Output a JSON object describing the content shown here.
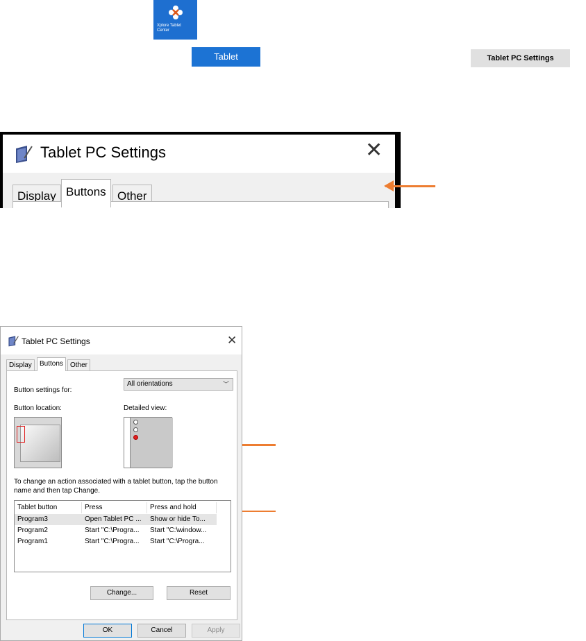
{
  "tiles": {
    "xplore": {
      "line1": "Xplore Tablet",
      "line2": "Center"
    },
    "tablet": "Tablet",
    "tablet_pc_settings": "Tablet PC Settings"
  },
  "zoom_window": {
    "title": "Tablet PC Settings",
    "close": "✕",
    "tabs": [
      "Display",
      "Buttons",
      "Other"
    ]
  },
  "dialog": {
    "title": "Tablet PC Settings",
    "close": "✕",
    "tabs": [
      "Display",
      "Buttons",
      "Other"
    ],
    "active_tab": "Buttons",
    "button_settings_label": "Button settings for:",
    "orientation_value": "All orientations",
    "button_location_label": "Button location:",
    "detailed_view_label": "Detailed view:",
    "instructions": "To change an action associated with a tablet button, tap the button name and then tap Change.",
    "table": {
      "headers": [
        "Tablet button",
        "Press",
        "Press and hold"
      ],
      "rows": [
        [
          "Program3",
          "Open Tablet PC ...",
          "Show or hide To..."
        ],
        [
          "Program2",
          "Start \"C:\\Progra...",
          "Start \"C:\\window..."
        ],
        [
          "Program1",
          "Start \"C:\\Progra...",
          "Start \"C:\\Progra..."
        ]
      ]
    },
    "change_button": "Change...",
    "reset_button": "Reset",
    "ok_button": "OK",
    "cancel_button": "Cancel",
    "apply_button": "Apply"
  },
  "colors": {
    "accent_arrow": "#ed7d31",
    "tile_blue": "#1c73d4",
    "selection_marker": "#e02020"
  }
}
